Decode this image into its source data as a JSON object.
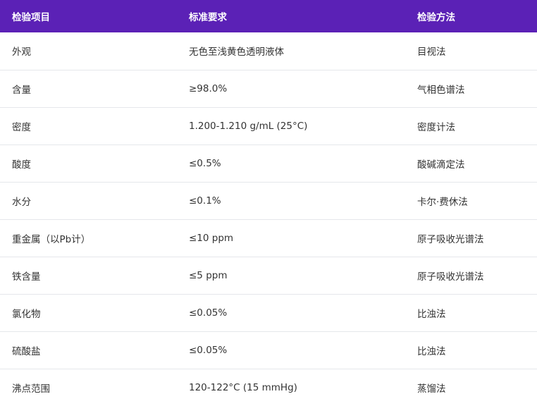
{
  "header": {
    "col1": "检验项目",
    "col2": "标准要求",
    "col3": "检验方法"
  },
  "rows": [
    {
      "item": "外观",
      "standard": "无色至浅黄色透明液体",
      "method": "目视法"
    },
    {
      "item": "含量",
      "standard": "≥98.0%",
      "method": "气相色谱法"
    },
    {
      "item": "密度",
      "standard": "1.200-1.210 g/mL (25°C)",
      "method": "密度计法"
    },
    {
      "item": "酸度",
      "standard": "≤0.5%",
      "method": "酸碱滴定法"
    },
    {
      "item": "水分",
      "standard": "≤0.1%",
      "method": "卡尔·费休法"
    },
    {
      "item": "重金属（以Pb计）",
      "standard": "≤10 ppm",
      "method": "原子吸收光谱法"
    },
    {
      "item": "铁含量",
      "standard": "≤5 ppm",
      "method": "原子吸收光谱法"
    },
    {
      "item": "氯化物",
      "standard": "≤0.05%",
      "method": "比浊法"
    },
    {
      "item": "硫酸盐",
      "standard": "≤0.05%",
      "method": "比浊法"
    },
    {
      "item": "沸点范围",
      "standard": "120-122°C (15 mmHg)",
      "method": "蒸馏法"
    }
  ],
  "colors": {
    "header_bg": "#5b21b6",
    "header_text": "#ffffff",
    "row_border": "#e5e7eb",
    "cell_text": "#333333"
  }
}
